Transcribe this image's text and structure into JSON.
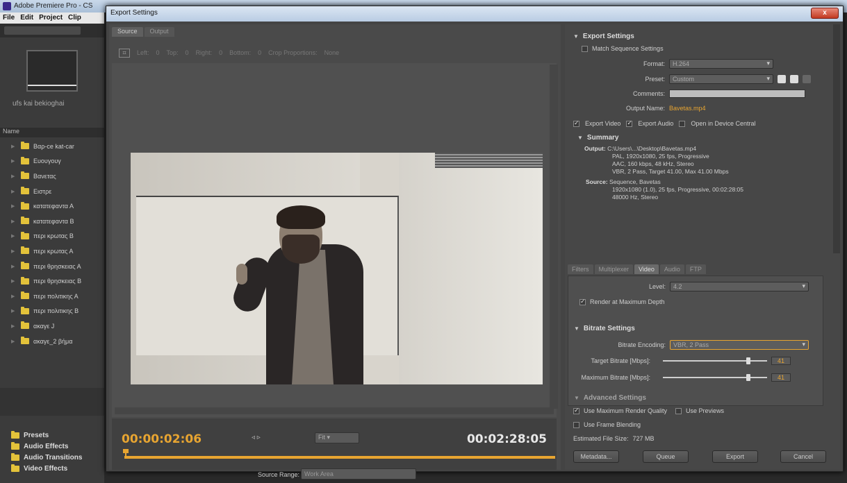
{
  "bg": {
    "app_title": "Adobe Premiere Pro - CS",
    "menu": [
      "File",
      "Edit",
      "Project",
      "Clip"
    ],
    "clip_caption": "ufs kai bekioghai",
    "name_header": "Name",
    "folders": [
      "Βαρ-ce kat-car",
      "Ευουγουγ",
      "Βανετας",
      "Eιστρε",
      "κατατεφαντα Α",
      "κατατεφαντα Β",
      "περι κρωτας Β",
      "περι κρωτας Α",
      "περι θρησκειας Α",
      "περι θρησκειας Β",
      "περι πολιτικης Α",
      "περι πολιτικης Β",
      "ακαγε J",
      "ακαγε_2 βήμα"
    ],
    "effects": [
      "Presets",
      "Audio Effects",
      "Audio Transitions",
      "Video Effects"
    ]
  },
  "dialog": {
    "title": "Export Settings",
    "close": "x",
    "tabs": [
      "Source",
      "Output"
    ],
    "crop_labels": [
      "Left:",
      "0",
      "Top:",
      "0",
      "Right:",
      "0",
      "Bottom:",
      "0",
      "Crop Proportions:",
      "None"
    ],
    "current_time": "00:00:02:06",
    "total_time": "00:02:28:05",
    "fit": "Fit",
    "source_range_label": "Source Range:",
    "source_range_value": "Work Area"
  },
  "settings": {
    "export_settings": "Export Settings",
    "match_sequence": "Match Sequence Settings",
    "format_label": "Format:",
    "format_value": "H.264",
    "preset_label": "Preset:",
    "preset_value": "Custom",
    "comments_label": "Comments:",
    "output_name_label": "Output Name:",
    "output_name_value": "Bavetas.mp4",
    "export_video": "Export Video",
    "export_audio": "Export Audio",
    "open_device_central": "Open in Device Central",
    "summary_head": "Summary",
    "output_key": "Output:",
    "output_lines": [
      "C:\\Users\\...\\Desktop\\Bavetas.mp4",
      "PAL, 1920x1080, 25 fps, Progressive",
      "AAC, 160 kbps, 48 kHz, Stereo",
      "VBR, 2 Pass, Target 41.00, Max 41.00 Mbps"
    ],
    "source_key": "Source:",
    "source_lines": [
      "Sequence, Bavetas",
      "1920x1080 (1.0), 25 fps, Progressive, 00:02:28:05",
      "48000 Hz, Stereo"
    ],
    "video_tabs": [
      "Filters",
      "Multiplexer",
      "Video",
      "Audio",
      "FTP"
    ],
    "level_label": "Level:",
    "level_value": "4.2",
    "render_max_depth": "Render at Maximum Depth",
    "bitrate_head": "Bitrate Settings",
    "bitrate_encoding_label": "Bitrate Encoding:",
    "bitrate_encoding_value": "VBR, 2 Pass",
    "target_bitrate_label": "Target Bitrate [Mbps]:",
    "target_bitrate_value": "41",
    "target_bitrate_level": 0.82,
    "max_bitrate_label": "Maximum Bitrate [Mbps]:",
    "max_bitrate_value": "41",
    "max_bitrate_level": 0.82,
    "advanced_head": "Advanced Settings",
    "use_max_render": "Use Maximum Render Quality",
    "use_previews": "Use Previews",
    "use_frame_blending": "Use Frame Blending",
    "est_size_label": "Estimated File Size:",
    "est_size_value": "727 MB",
    "metadata_btn": "Metadata...",
    "queue_btn": "Queue",
    "export_btn": "Export",
    "cancel_btn": "Cancel"
  },
  "colors": {
    "accent": "#e8a531",
    "folder": "#e3c23a"
  }
}
